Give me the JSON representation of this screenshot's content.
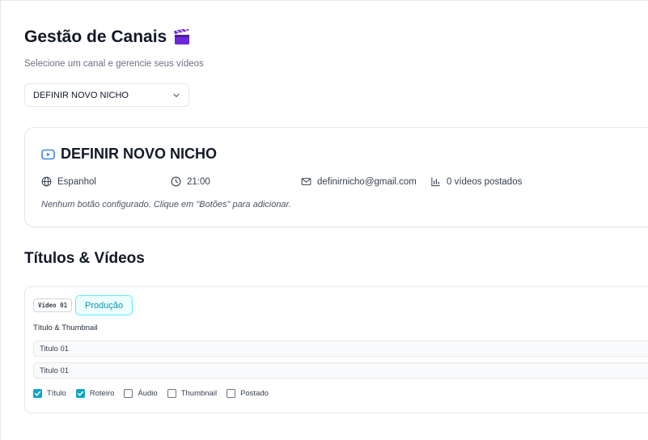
{
  "header": {
    "title": "Gestão de Canais",
    "title_emoji": "clapperboard-icon",
    "subtitle": "Selecione um canal e gerencie seus vídeos"
  },
  "channel_select": {
    "value": "DEFINIR NOVO NICHO",
    "icon": "chevron-down-icon"
  },
  "channel_card": {
    "name": "DEFINIR NOVO NICHO",
    "icon": "youtube-icon",
    "language": "Espanhol",
    "time": "21:00",
    "email": "definirnicho@gmail.com",
    "videos_posted": "0 vídeos postados",
    "empty_buttons_hint": "Nenhum botão configurado. Clique em \"Botões\" para adicionar."
  },
  "videos_section": {
    "title": "Títulos & Vídeos",
    "items": [
      {
        "badge": "Vídeo 01",
        "status": "Produção",
        "field_label": "Título & Thumbnail",
        "title_value": "Titulo 01",
        "thumbnail_value": "Titulo 01",
        "checklist": [
          {
            "label": "Título",
            "checked": true
          },
          {
            "label": "Roteiro",
            "checked": true
          },
          {
            "label": "Áudio",
            "checked": false
          },
          {
            "label": "Thumbnail",
            "checked": false
          },
          {
            "label": "Postado",
            "checked": false
          }
        ]
      }
    ]
  },
  "colors": {
    "accent": "#0ea5c6",
    "status_bg": "#ecfeff",
    "status_border": "#67e8f9",
    "youtube_icon": "#3b82f6"
  }
}
